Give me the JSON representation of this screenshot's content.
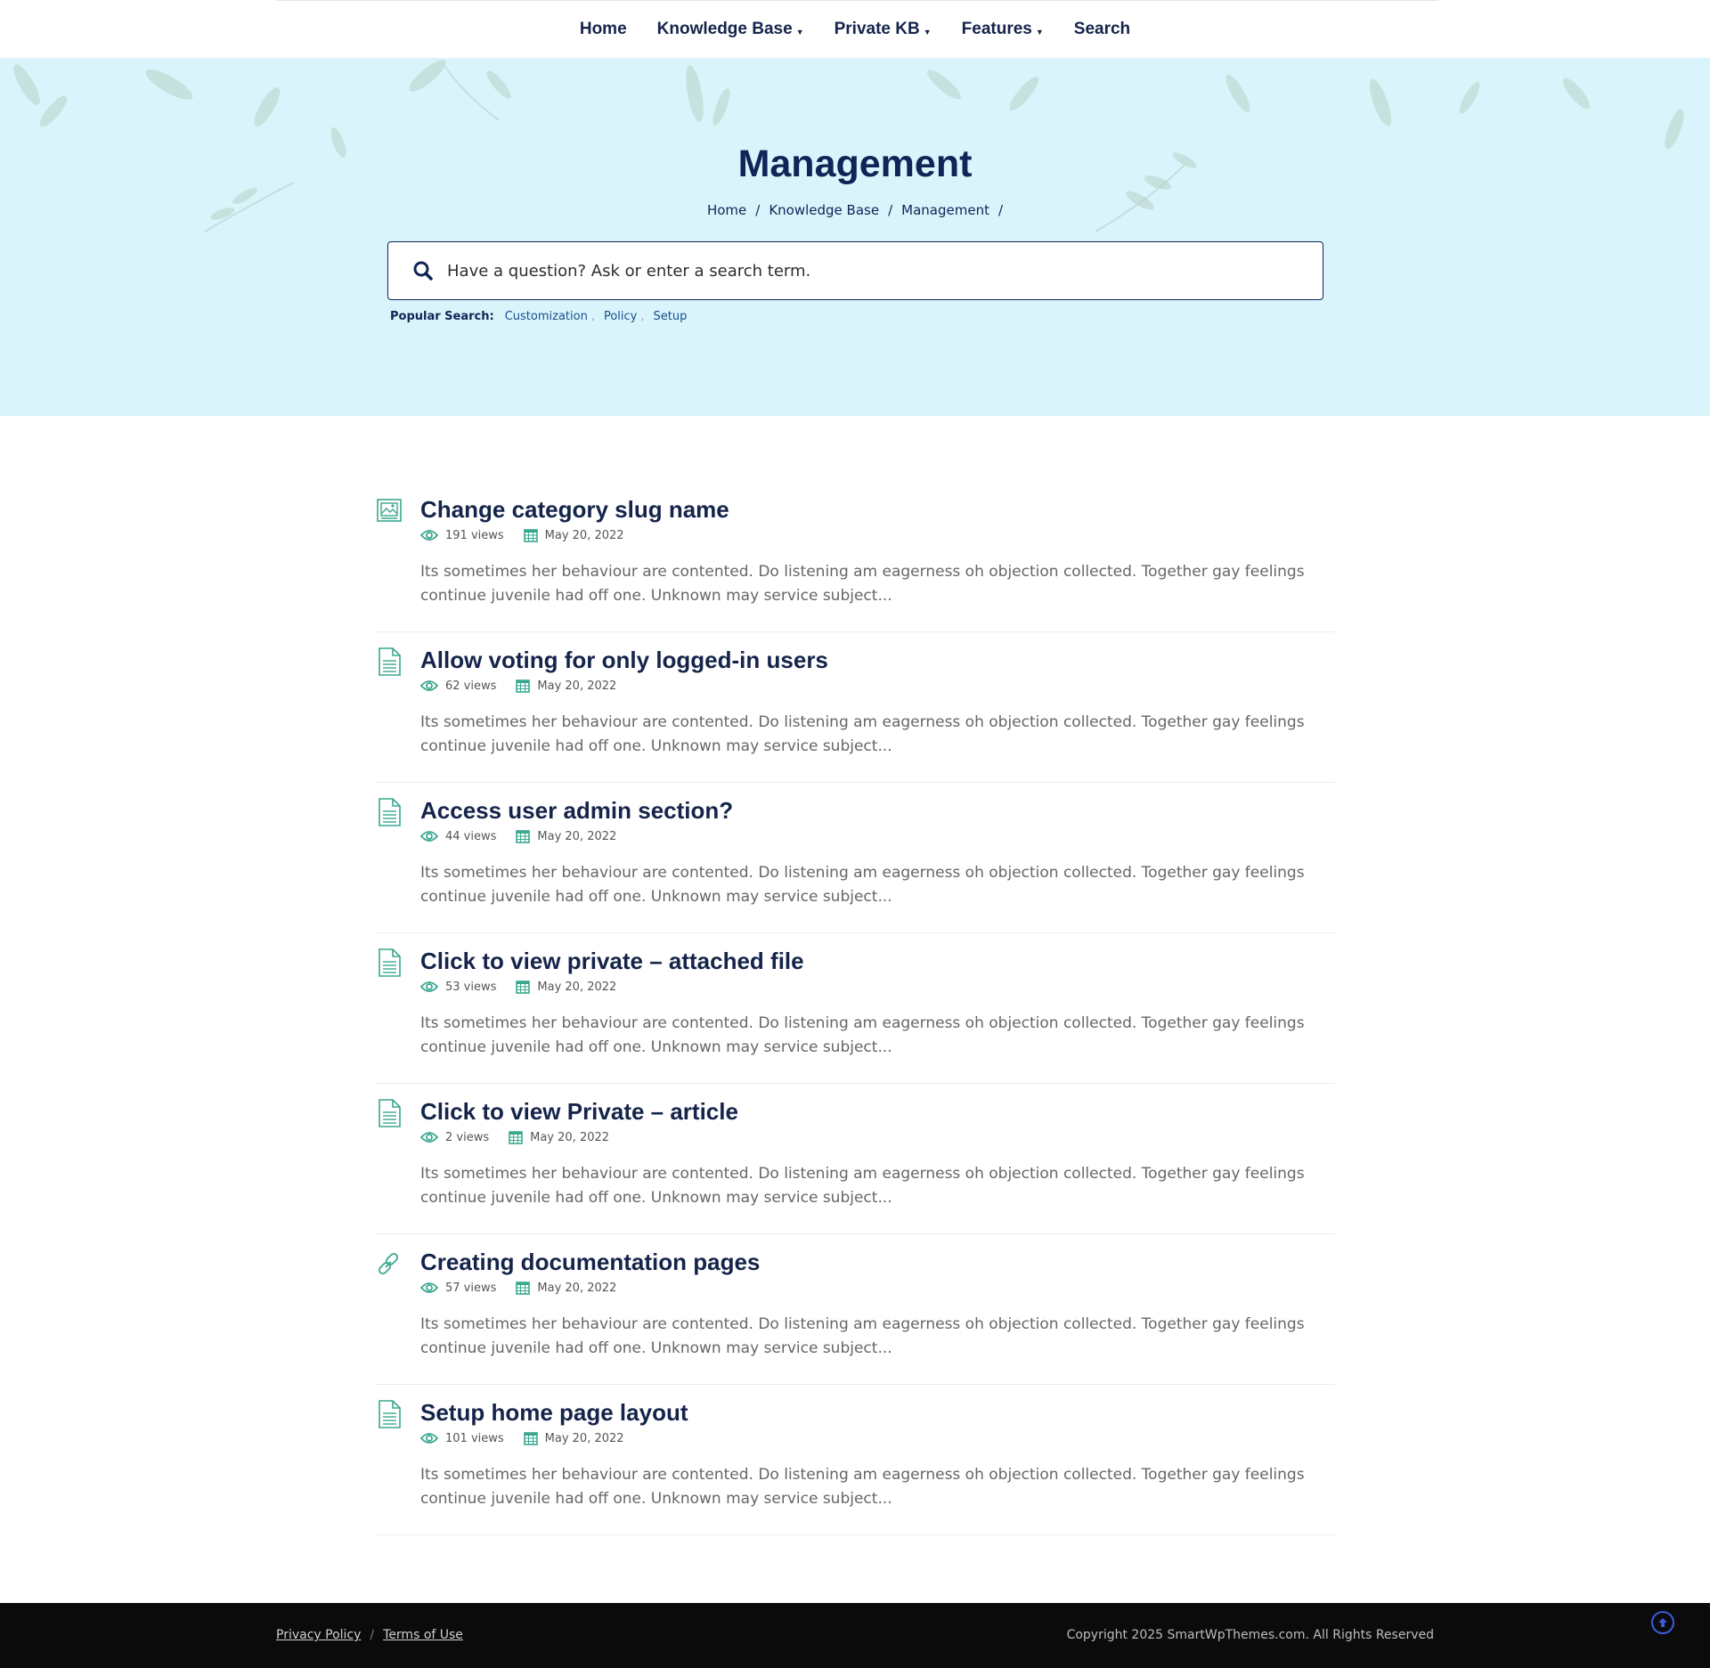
{
  "nav": {
    "items": [
      {
        "label": "Home",
        "has_caret": false
      },
      {
        "label": "Knowledge Base",
        "has_caret": true
      },
      {
        "label": "Private KB",
        "has_caret": true
      },
      {
        "label": "Features",
        "has_caret": true
      },
      {
        "label": "Search",
        "has_caret": false
      }
    ]
  },
  "hero": {
    "title": "Management",
    "breadcrumb": [
      "Home",
      "Knowledge Base",
      "Management"
    ],
    "search_placeholder": "Have a question? Ask or enter a search term.",
    "popular_label": "Popular Search:",
    "popular_terms": [
      "Customization",
      "Policy",
      "Setup"
    ]
  },
  "articles": [
    {
      "title": "Change category slug name",
      "views": "191 views",
      "date": "May 20, 2022",
      "icon": "image-doc-icon",
      "excerpt": "Its sometimes her behaviour are contented. Do listening am eagerness oh objection collected. Together gay feelings continue juvenile had off one. Unknown may service subject..."
    },
    {
      "title": "Allow voting for only logged-in users",
      "views": "62 views",
      "date": "May 20, 2022",
      "icon": "document-icon",
      "excerpt": "Its sometimes her behaviour are contented. Do listening am eagerness oh objection collected. Together gay feelings continue juvenile had off one. Unknown may service subject..."
    },
    {
      "title": "Access user admin section?",
      "views": "44 views",
      "date": "May 20, 2022",
      "icon": "document-icon",
      "excerpt": "Its sometimes her behaviour are contented. Do listening am eagerness oh objection collected. Together gay feelings continue juvenile had off one. Unknown may service subject..."
    },
    {
      "title": "Click to view private – attached file",
      "views": "53 views",
      "date": "May 20, 2022",
      "icon": "document-icon",
      "excerpt": "Its sometimes her behaviour are contented. Do listening am eagerness oh objection collected. Together gay feelings continue juvenile had off one. Unknown may service subject..."
    },
    {
      "title": "Click to view Private – article",
      "views": "2 views",
      "date": "May 20, 2022",
      "icon": "document-icon",
      "excerpt": "Its sometimes her behaviour are contented. Do listening am eagerness oh objection collected. Together gay feelings continue juvenile had off one. Unknown may service subject..."
    },
    {
      "title": "Creating documentation pages",
      "views": "57 views",
      "date": "May 20, 2022",
      "icon": "link-icon",
      "excerpt": "Its sometimes her behaviour are contented. Do listening am eagerness oh objection collected. Together gay feelings continue juvenile had off one. Unknown may service subject..."
    },
    {
      "title": "Setup home page layout",
      "views": "101 views",
      "date": "May 20, 2022",
      "icon": "document-icon",
      "excerpt": "Its sometimes her behaviour are contented. Do listening am eagerness oh objection collected. Together gay feelings continue juvenile had off one. Unknown may service subject..."
    }
  ],
  "footer": {
    "links": [
      "Privacy Policy",
      "Terms of Use"
    ],
    "copyright": "Copyright 2025 SmartWpThemes.com. All Rights Reserved"
  },
  "colors": {
    "accent_teal": "#3aa88f",
    "navy": "#0f2557",
    "hero_bg": "#d9f5fb",
    "footer_bg": "#0b0b0c"
  }
}
